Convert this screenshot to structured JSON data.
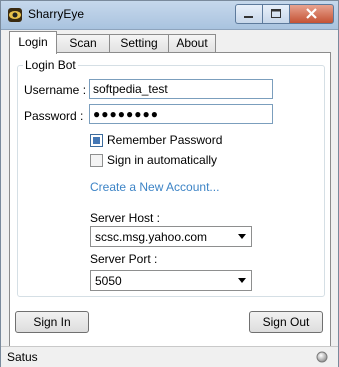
{
  "window": {
    "title": "SharryEye"
  },
  "tabs": [
    {
      "label": "Login",
      "active": true
    },
    {
      "label": "Scan",
      "active": false
    },
    {
      "label": "Setting",
      "active": false
    },
    {
      "label": "About",
      "active": false
    }
  ],
  "login": {
    "group_label": "Login Bot",
    "username_label": "Username :",
    "username_value": "softpedia_test",
    "password_label": "Password :",
    "password_value": "●●●●●●●●",
    "remember_label": "Remember Password",
    "remember_checked": true,
    "auto_label": "Sign in automatically",
    "auto_checked": false,
    "create_account_link": "Create a New Account...",
    "server_host_label": "Server Host :",
    "server_host_value": "scsc.msg.yahoo.com",
    "server_port_label": "Server Port :",
    "server_port_value": "5050",
    "sign_in_label": "Sign In",
    "sign_out_label": "Sign Out"
  },
  "status": {
    "text": "Satus"
  },
  "colors": {
    "link": "#3d84c6",
    "checkbox_fill": "#4477b5",
    "tab_border": "#8c8c8c"
  }
}
